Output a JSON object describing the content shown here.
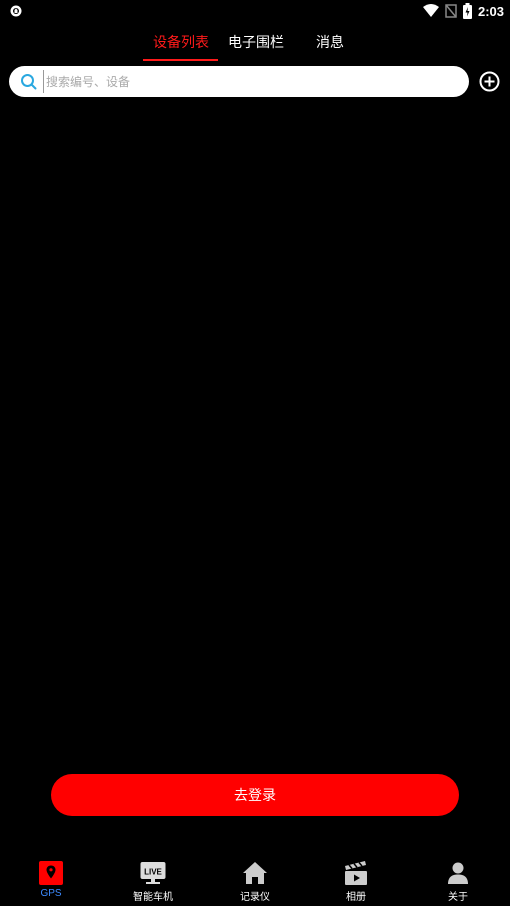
{
  "status_bar": {
    "time": "2:03",
    "icons": [
      "app-notification-icon",
      "wifi-icon",
      "signal-off-icon",
      "battery-charging-icon"
    ]
  },
  "tabs": [
    {
      "label": "设备列表",
      "active": true
    },
    {
      "label": "电子围栏",
      "active": false
    },
    {
      "label": "消息",
      "active": false
    }
  ],
  "search": {
    "placeholder": "搜索编号、设备",
    "value": ""
  },
  "login_button": {
    "label": "去登录"
  },
  "bottom_nav": [
    {
      "label": "GPS",
      "icon": "map-pin-icon",
      "active": true
    },
    {
      "label": "智能车机",
      "icon": "live-tv-icon",
      "active": false
    },
    {
      "label": "记录仪",
      "icon": "home-icon",
      "active": false
    },
    {
      "label": "相册",
      "icon": "clapperboard-icon",
      "active": false
    },
    {
      "label": "关于",
      "icon": "user-icon",
      "active": false
    }
  ],
  "colors": {
    "accent": "#ff0000",
    "tab_active": "#ff1a1a",
    "nav_active_label": "#3d8bff",
    "background": "#000000"
  }
}
